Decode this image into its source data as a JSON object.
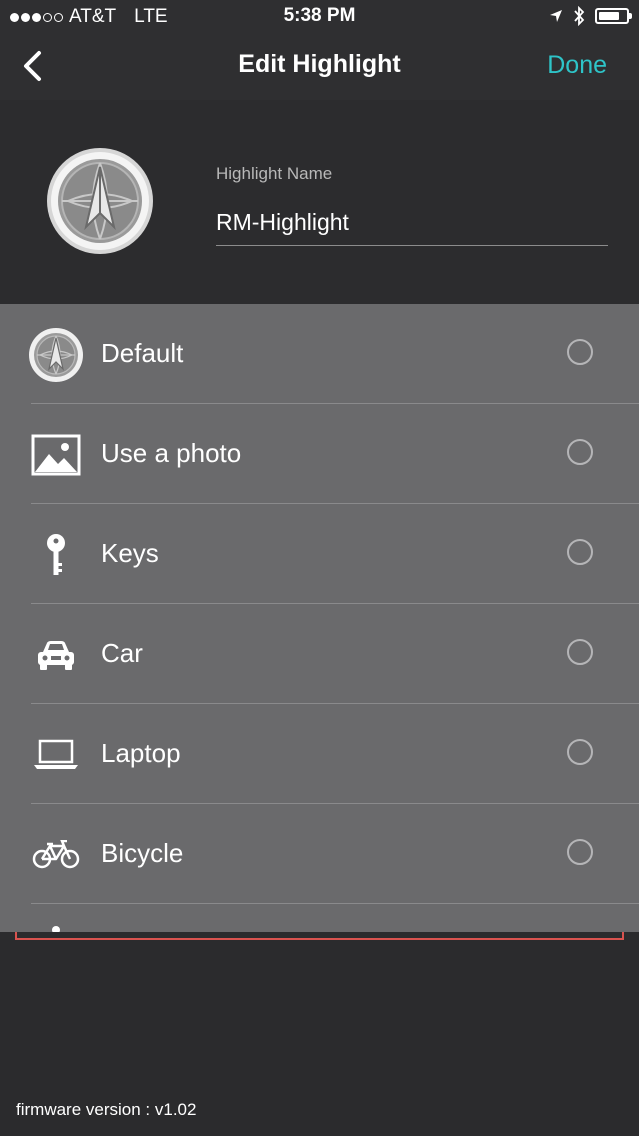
{
  "status_bar": {
    "carrier": "AT&T",
    "network": "LTE",
    "time": "5:38 PM",
    "signal_dots_filled": 3,
    "signal_dots_total": 5,
    "battery_level": 0.75
  },
  "nav": {
    "title": "Edit Highlight",
    "done_label": "Done",
    "done_color": "#2ec4c8"
  },
  "header": {
    "field_label": "Highlight Name",
    "name_value": "RM-Highlight"
  },
  "icon_options": [
    {
      "label": "Default",
      "icon": "compass-icon",
      "selected": false
    },
    {
      "label": "Use a photo",
      "icon": "photo-icon",
      "selected": false
    },
    {
      "label": "Keys",
      "icon": "key-icon",
      "selected": false
    },
    {
      "label": "Car",
      "icon": "car-icon",
      "selected": false
    },
    {
      "label": "Laptop",
      "icon": "laptop-icon",
      "selected": false
    },
    {
      "label": "Bicycle",
      "icon": "bicycle-icon",
      "selected": false
    }
  ],
  "footer": {
    "firmware": "firmware version : v1.02"
  }
}
